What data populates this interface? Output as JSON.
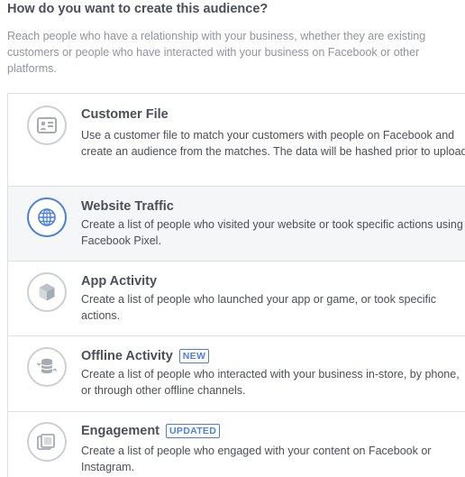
{
  "heading": "How do you want to create this audience?",
  "intro": "Reach people who have a relationship with your business, whether they are existing customers or people who have interacted with your business on Facebook or other platforms.",
  "options": [
    {
      "title": "Customer File",
      "description": "Use a customer file to match your customers with people on Facebook and create an audience from the matches. The data will be hashed prior to upload.",
      "icon": "contact-card-icon"
    },
    {
      "title": "Website Traffic",
      "description": "Create a list of people who visited your website or took specific actions using Facebook Pixel.",
      "icon": "globe-icon",
      "highlighted": true
    },
    {
      "title": "App Activity",
      "description": "Create a list of people who launched your app or game, or took specific actions.",
      "icon": "cube-icon"
    },
    {
      "title": "Offline Activity",
      "badge": "NEW",
      "description": "Create a list of people who interacted with your business in-store, by phone, or through other offline channels.",
      "icon": "database-sync-icon"
    },
    {
      "title": "Engagement",
      "badge": "UPDATED",
      "description": "Create a list of people who engaged with your content on Facebook or Instagram.",
      "icon": "layered-content-icon"
    }
  ],
  "colors": {
    "accent": "#4a7fe0",
    "icon_gray": "#a7abb2",
    "highlight_bg": "#f5f6f7"
  }
}
